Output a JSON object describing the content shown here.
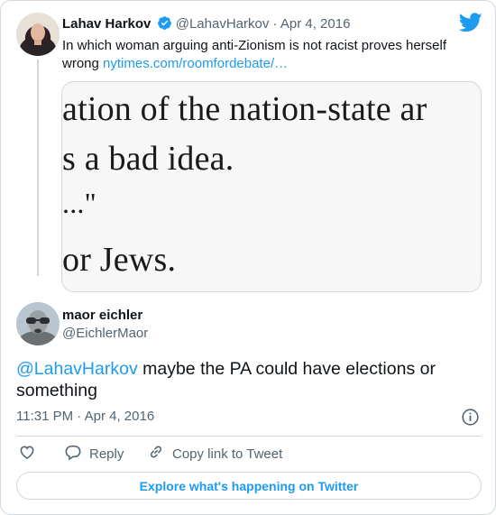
{
  "parent_tweet": {
    "author_name": "Lahav Harkov",
    "handle": "@LahavHarkov",
    "separator": "·",
    "date": "Apr 4, 2016",
    "text": "In which woman arguing anti-Zionism is not racist proves herself wrong",
    "link": "nytimes.com/roomfordebate/…",
    "media_lines": [
      "ation of the nation-state ar",
      "s a bad idea.",
      "...\"",
      "or Jews."
    ]
  },
  "reply_tweet": {
    "author_name": "maor eichler",
    "handle": "@EichlerMaor",
    "mention": "@LahavHarkov",
    "text": " maybe the PA could have elections or something",
    "time": "11:31 PM",
    "separator": "·",
    "date": "Apr 4, 2016"
  },
  "actions": {
    "like_icon": "heart-icon",
    "reply_label": "Reply",
    "copy_link_label": "Copy link to Tweet"
  },
  "explore_label": "Explore what's happening on Twitter",
  "colors": {
    "accent": "#1d9bf0",
    "muted": "#536471",
    "border": "#cfd9de"
  }
}
